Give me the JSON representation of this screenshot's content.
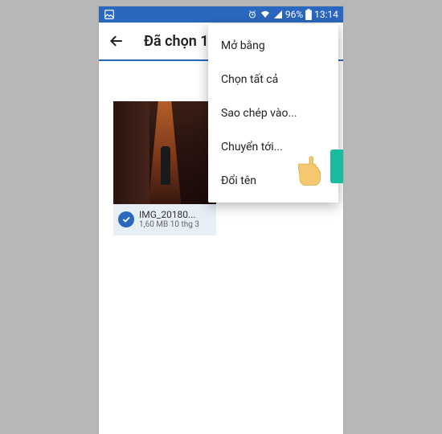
{
  "statusbar": {
    "battery_pct": "96%",
    "time": "13:14"
  },
  "toolbar": {
    "title": "Đã chọn 1"
  },
  "thumbnail": {
    "filename": "IMG_20180...",
    "meta": "1,60 MB 10 thg 3"
  },
  "menu": {
    "items": [
      "Mở bằng",
      "Chọn tất cả",
      "Sao chép vào...",
      "Chuyển tới...",
      "Đổi tên"
    ]
  }
}
